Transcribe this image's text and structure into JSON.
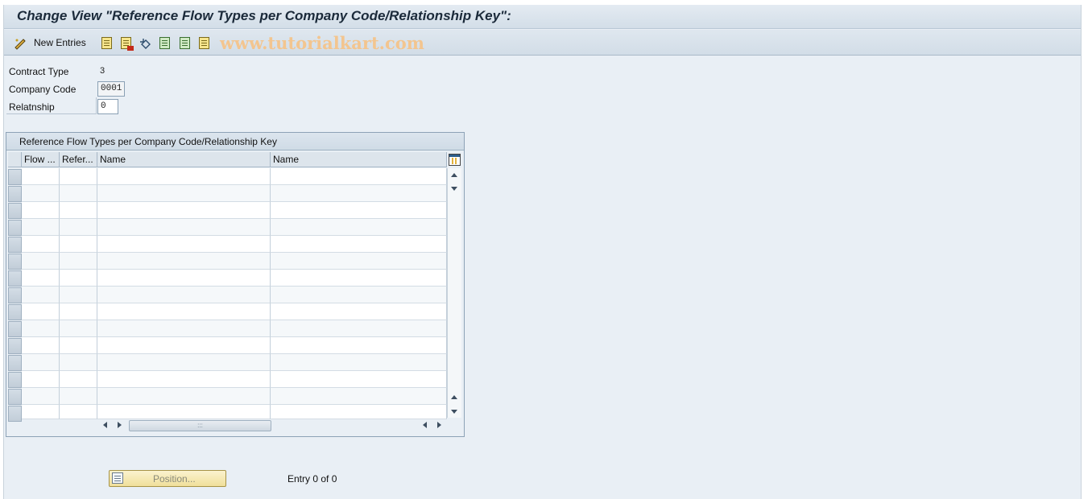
{
  "header": {
    "title": "Change View \"Reference Flow Types per Company Code/Relationship Key\":"
  },
  "toolbar": {
    "new_entries_label": "New Entries",
    "watermark": "www.tutorialkart.com",
    "icons": [
      "edit-pencil-icon",
      "copy-icon",
      "delete-icon",
      "undo-icon",
      "select-all-icon",
      "select-block-icon",
      "deselect-all-icon"
    ]
  },
  "fields": {
    "contract_type": {
      "label": "Contract Type",
      "value": "3"
    },
    "company_code": {
      "label": "Company Code",
      "value": "0001"
    },
    "relationship": {
      "label": "Relatnship",
      "value": "0"
    }
  },
  "table": {
    "caption": "Reference Flow Types per Company Code/Relationship Key",
    "columns": [
      "Flow ...",
      "Refer...",
      "Name",
      "Name"
    ],
    "rows": []
  },
  "footer": {
    "position_label": "Position...",
    "entry_text": "Entry 0 of 0"
  },
  "colors": {
    "background": "#e9eff5",
    "title_text": "#1b2a3a",
    "button_yellow": "#f0df9a",
    "watermark": "#f3c58f"
  }
}
